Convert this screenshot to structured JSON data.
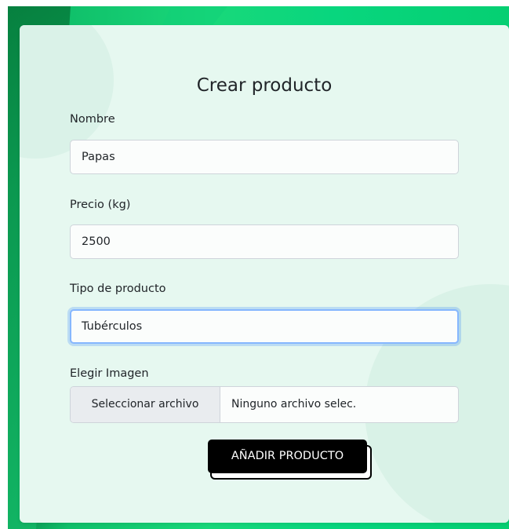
{
  "form": {
    "title": "Crear producto",
    "fields": [
      {
        "label": "Nombre",
        "value": "Papas"
      },
      {
        "label": "Precio (kg)",
        "value": "2500"
      },
      {
        "label": "Tipo de producto",
        "value": "Tubérculos"
      }
    ],
    "image": {
      "label": "Elegir Imagen",
      "button_label": "Seleccionar archivo",
      "file_name": "Ninguno archivo selec."
    },
    "submit_label": "AÑADIR PRODUCTO"
  },
  "colors": {
    "background_green": "#19d87a",
    "card": "#e6f8f0",
    "focus_border": "#86b7fe",
    "submit_bg": "#000000"
  }
}
